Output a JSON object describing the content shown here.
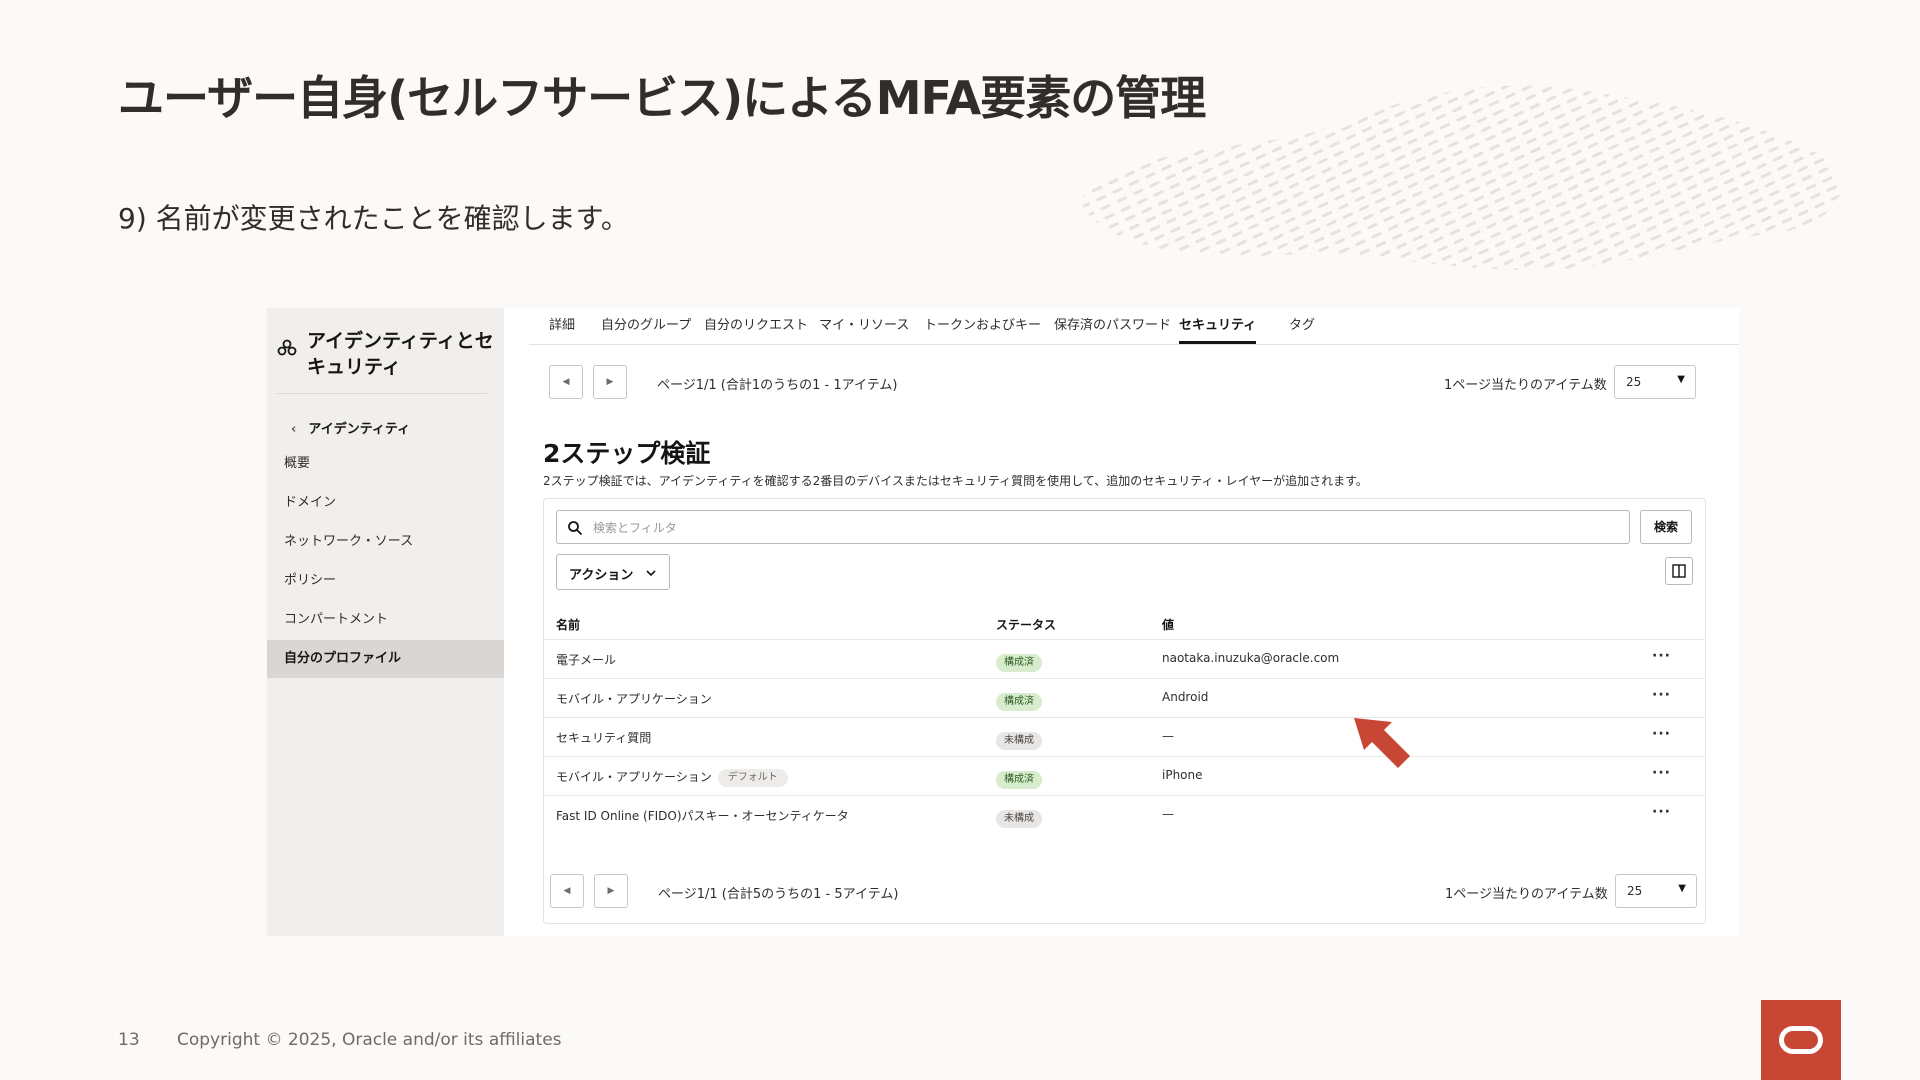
{
  "slide": {
    "title": "ユーザー自身(セルフサービス)によるMFA要素の管理",
    "step": "9) 名前が変更されたことを確認します。",
    "page_number": "13",
    "copyright": "Copyright © 2025, Oracle and/or its affiliates",
    "accent_color": "#c74634"
  },
  "sidebar": {
    "title": "アイデンティティとセキュリティ",
    "back_label": "アイデンティティ",
    "items": [
      {
        "label": "概要"
      },
      {
        "label": "ドメイン"
      },
      {
        "label": "ネットワーク・ソース"
      },
      {
        "label": "ポリシー"
      },
      {
        "label": "コンパートメント"
      },
      {
        "label": "自分のプロファイル",
        "active": true
      }
    ]
  },
  "tabs": [
    {
      "label": "詳細"
    },
    {
      "label": "自分のグループ"
    },
    {
      "label": "自分のリクエスト"
    },
    {
      "label": "マイ・リソース"
    },
    {
      "label": "トークンおよびキー"
    },
    {
      "label": "保存済のパスワード"
    },
    {
      "label": "セキュリティ",
      "active": true
    },
    {
      "label": "タグ"
    }
  ],
  "pager_top": {
    "info": "ページ1/1 (合計1のうちの1 - 1アイテム)",
    "per_page_label": "1ページ当たりのアイテム数",
    "per_page_value": "25"
  },
  "section": {
    "title": "2ステップ検証",
    "description": "2ステップ検証では、アイデンティティを確認する2番目のデバイスまたはセキュリティ質問を使用して、追加のセキュリティ・レイヤーが追加されます。"
  },
  "search": {
    "placeholder": "検索とフィルタ",
    "button_label": "検索"
  },
  "actions_label": "アクション",
  "table": {
    "headers": {
      "name": "名前",
      "status": "ステータス",
      "value": "値"
    },
    "rows": [
      {
        "name": "電子メール",
        "status": "構成済",
        "value": "naotaka.inuzuka@oracle.com",
        "tag": ""
      },
      {
        "name": "モバイル・アプリケーション",
        "status": "構成済",
        "value": "Android",
        "tag": ""
      },
      {
        "name": "セキュリティ質問",
        "status": "未構成",
        "value": "—",
        "tag": ""
      },
      {
        "name": "モバイル・アプリケーション",
        "status": "構成済",
        "value": "iPhone",
        "tag": "デフォルト"
      },
      {
        "name": "Fast ID Online (FIDO)パスキー・オーセンティケータ",
        "status": "未構成",
        "value": "—",
        "tag": ""
      }
    ]
  },
  "pager_bottom": {
    "info": "ページ1/1 (合計5のうちの1 - 5アイテム)",
    "per_page_label": "1ページ当たりのアイテム数",
    "per_page_value": "25"
  }
}
